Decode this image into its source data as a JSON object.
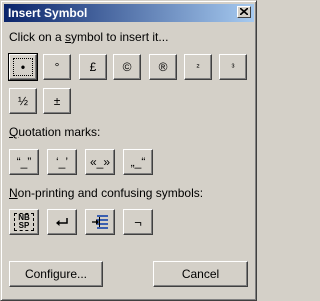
{
  "window": {
    "title": "Insert Symbol",
    "close_icon": "close-icon"
  },
  "instruction": {
    "before": "Click on a ",
    "underlined": "s",
    "after": "ymbol to insert it..."
  },
  "common_symbols": [
    {
      "label": "•",
      "selected": true
    },
    {
      "label": "°"
    },
    {
      "label": "£"
    },
    {
      "label": "©"
    },
    {
      "label": "®"
    },
    {
      "label": "²"
    },
    {
      "label": "³"
    },
    {
      "label": "½"
    },
    {
      "label": "±"
    }
  ],
  "quotation": {
    "heading_underlined": "Q",
    "heading_rest": "uotation marks:",
    "symbols": [
      {
        "label": "“_”"
      },
      {
        "label": "‘_’"
      },
      {
        "label": "«_»"
      },
      {
        "label": "„_“"
      }
    ]
  },
  "nonprinting": {
    "heading_underlined": "N",
    "heading_rest": "on-printing and confusing symbols:",
    "nbsp_top": "NB",
    "nbsp_bottom": "SP",
    "return_icon": "return-arrow-icon",
    "tab_icon": "tab-icon",
    "not_sign": "¬"
  },
  "buttons": {
    "configure": "Configure...",
    "cancel": "Cancel"
  },
  "colors": {
    "titlebar_start": "#0a246a",
    "titlebar_end": "#a6caf0",
    "face": "#d4d0c8"
  }
}
